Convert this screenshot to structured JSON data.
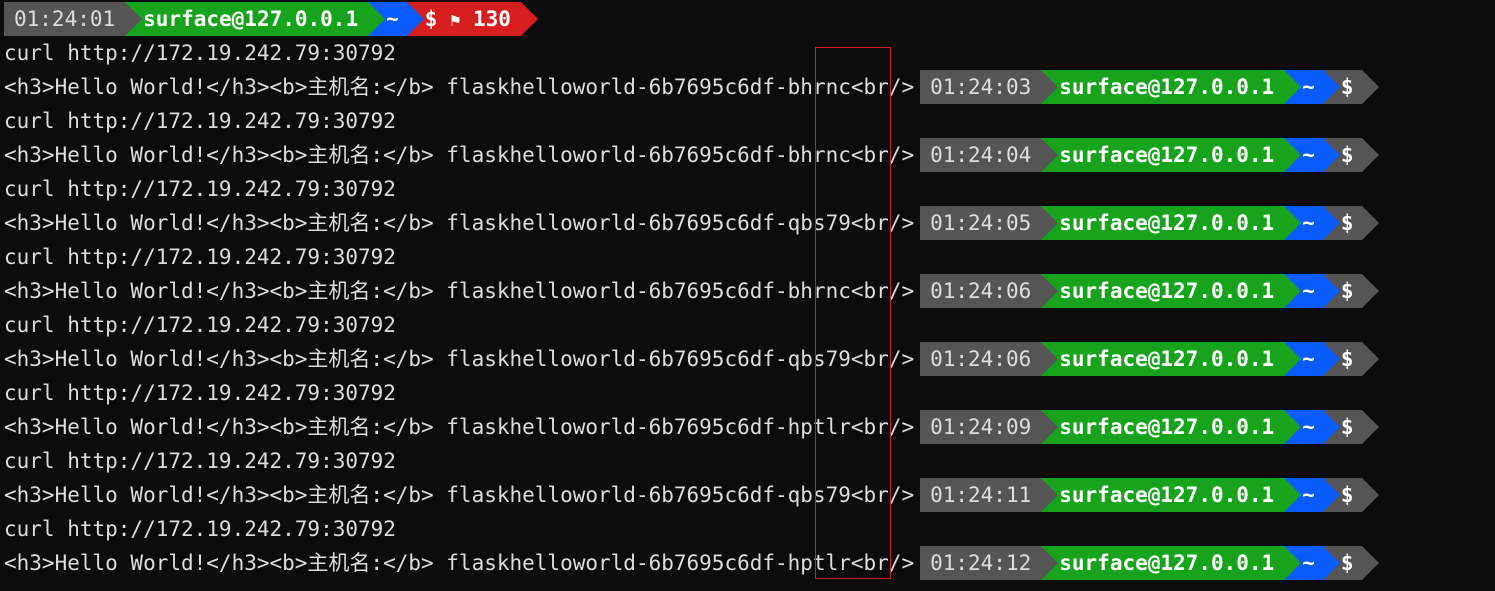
{
  "prompt": {
    "host": "surface@127.0.0.1",
    "dir": "~",
    "dollar": "$",
    "err_code": "130",
    "flag": "⚑"
  },
  "cmd": "curl http://172.19.242.79:30792",
  "resp_prefix": "<h3>Hello World!</h3><b>主机名:</b> flaskhelloworld-6b7695c6df-",
  "resp_suffix": "<br/>",
  "top_time": "01:24:01",
  "lines": [
    {
      "pod": "bhrnc",
      "time": "01:24:03"
    },
    {
      "pod": "bhrnc",
      "time": "01:24:04"
    },
    {
      "pod": "qbs79",
      "time": "01:24:05"
    },
    {
      "pod": "bhrnc",
      "time": "01:24:06"
    },
    {
      "pod": "qbs79",
      "time": "01:24:06"
    },
    {
      "pod": "hptlr",
      "time": "01:24:09"
    },
    {
      "pod": "qbs79",
      "time": "01:24:11"
    },
    {
      "pod": "hptlr",
      "time": "01:24:12"
    }
  ]
}
